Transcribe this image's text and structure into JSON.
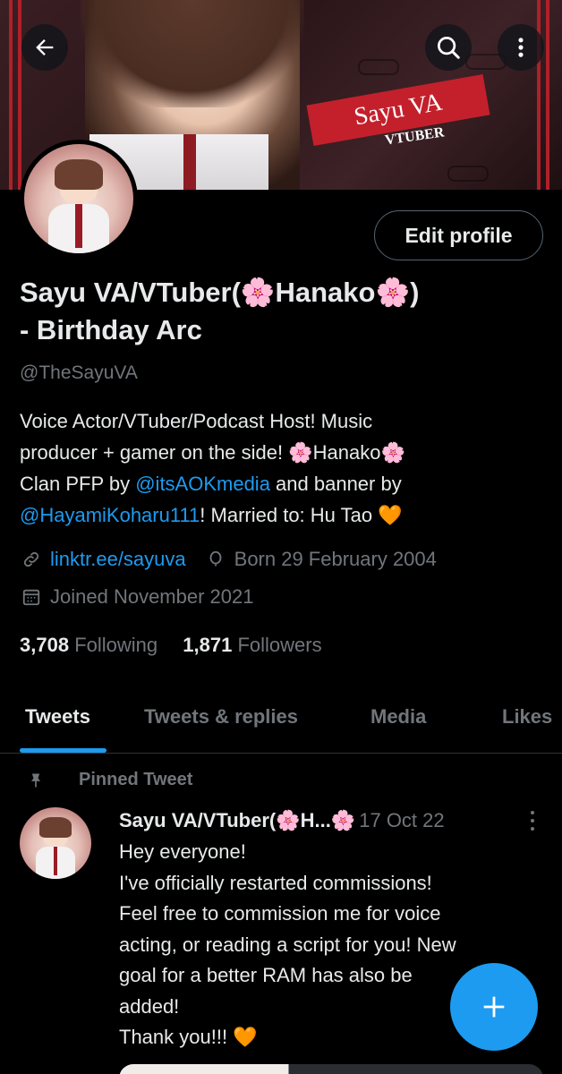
{
  "header": {
    "banner_title": "Sayu VA",
    "banner_subtitle": "VTUBER",
    "back_icon": "arrow-left-icon",
    "search_icon": "search-icon",
    "more_icon": "more-vertical-icon"
  },
  "profile": {
    "edit_button_label": "Edit profile",
    "name_line1": "Sayu VA/VTuber(🌸Hanako🌸)",
    "name_line2": "- Birthday Arc",
    "handle": "@TheSayuVA",
    "bio": {
      "line1": "Voice Actor/VTuber/Podcast Host! Music",
      "line2": "producer + gamer on the side! 🌸Hanako🌸",
      "line3_pre": "Clan PFP by ",
      "line3_link": "@itsAOKmedia",
      "line3_post": " and banner by",
      "line4_link": "@HayamiKoharu111",
      "line4_post": "! Married to: Hu Tao 🧡"
    },
    "website": "linktr.ee/sayuva",
    "birthday": "Born 29 February 2004",
    "joined": "Joined November 2021",
    "following_count": "3,708",
    "following_label": "Following",
    "followers_count": "1,871",
    "followers_label": "Followers"
  },
  "tabs": [
    {
      "label": "Tweets",
      "active": true
    },
    {
      "label": "Tweets & replies",
      "active": false
    },
    {
      "label": "Media",
      "active": false
    },
    {
      "label": "Likes",
      "active": false
    }
  ],
  "pinned_tweet": {
    "pinned_label": "Pinned Tweet",
    "author": "Sayu VA/VTuber(🌸H...🌸",
    "date": "17 Oct 22",
    "lines": [
      "Hey everyone!",
      "I've officially restarted commissions!",
      "Feel free to commission me for voice",
      "acting, or reading a script for you! New",
      "goal for a better RAM has also be",
      "added!",
      "Thank you!!! 🧡"
    ]
  },
  "fab": {
    "icon": "plus-icon"
  },
  "colors": {
    "accent": "#1d9bf0",
    "background": "#000000",
    "secondary_text": "#71767b",
    "primary_text": "#e7e9ea"
  }
}
